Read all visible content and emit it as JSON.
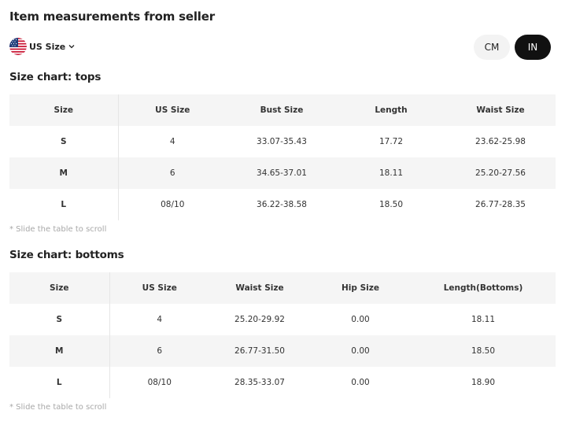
{
  "header": {
    "title": "Item measurements from seller",
    "size_system": "US Size",
    "units": {
      "cm_label": "CM",
      "in_label": "IN",
      "selected": "IN"
    }
  },
  "tops": {
    "title": "Size chart: tops",
    "columns": [
      "Size",
      "US Size",
      "Bust Size",
      "Length",
      "Waist Size"
    ],
    "rows": [
      [
        "S",
        "4",
        "33.07-35.43",
        "17.72",
        "23.62-25.98"
      ],
      [
        "M",
        "6",
        "34.65-37.01",
        "18.11",
        "25.20-27.56"
      ],
      [
        "L",
        "08/10",
        "36.22-38.58",
        "18.50",
        "26.77-28.35"
      ]
    ],
    "hint": "* Slide the table to scroll"
  },
  "bottoms": {
    "title": "Size chart: bottoms",
    "columns": [
      "Size",
      "US Size",
      "Waist Size",
      "Hip Size",
      "Length(Bottoms)"
    ],
    "rows": [
      [
        "S",
        "4",
        "25.20-29.92",
        "0.00",
        "18.11"
      ],
      [
        "M",
        "6",
        "26.77-31.50",
        "0.00",
        "18.50"
      ],
      [
        "L",
        "08/10",
        "28.35-33.07",
        "0.00",
        "18.90"
      ]
    ],
    "hint": "* Slide the table to scroll"
  },
  "icons": {
    "flag": "us-flag-icon",
    "dropdown": "chevron-down-icon"
  },
  "colors": {
    "active_toggle": "#111111",
    "inactive_toggle": "#f3f3f3",
    "row_shade": "#f5f5f5",
    "hint": "#a8a8a8"
  }
}
